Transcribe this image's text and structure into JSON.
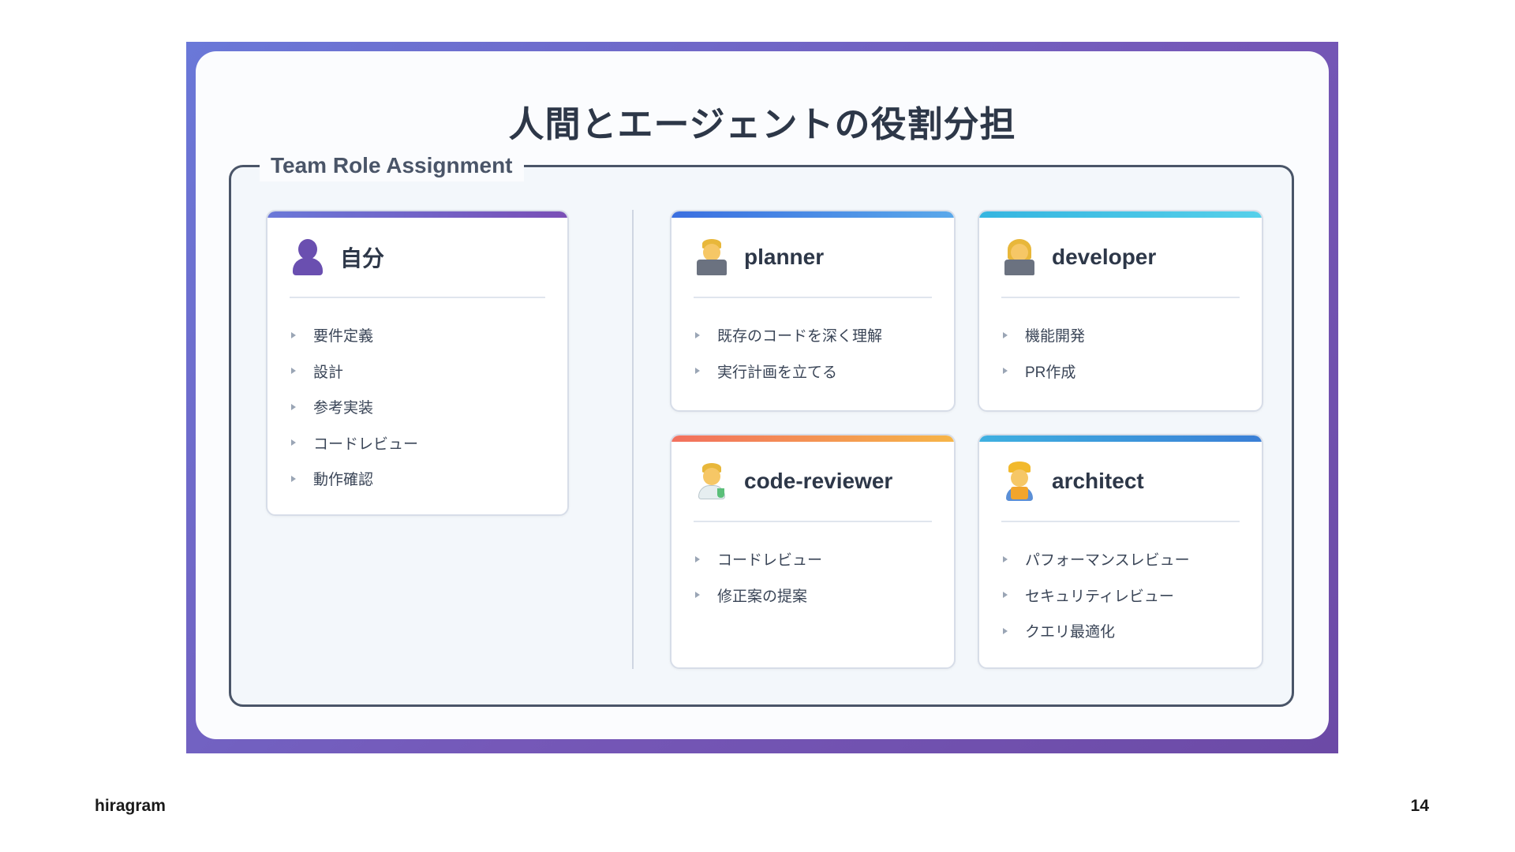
{
  "slide": {
    "title": "人間とエージェントの役割分担",
    "group_label": "Team Role Assignment"
  },
  "roles": [
    {
      "name": "自分",
      "icon": "person-silhouette-icon",
      "accent": "#7b5cc4",
      "items": [
        "要件定義",
        "設計",
        "参考実装",
        "コードレビュー",
        "動作確認"
      ]
    },
    {
      "name": "planner",
      "icon": "technologist-man-icon",
      "accent": "#3b6fe0",
      "items": [
        "既存のコードを深く理解",
        "実行計画を立てる"
      ]
    },
    {
      "name": "developer",
      "icon": "technologist-woman-icon",
      "accent": "#3fc1e4",
      "items": [
        "機能開発",
        "PR作成"
      ]
    },
    {
      "name": "code-reviewer",
      "icon": "scientist-man-icon",
      "accent": "#f2705e",
      "items": [
        "コードレビュー",
        "修正案の提案"
      ]
    },
    {
      "name": "architect",
      "icon": "construction-worker-icon",
      "accent": "#3a9ad9",
      "items": [
        "パフォーマンスレビュー",
        "セキュリティレビュー",
        "クエリ最適化"
      ]
    }
  ],
  "footer": {
    "brand": "hiragram",
    "page_number": "14"
  }
}
